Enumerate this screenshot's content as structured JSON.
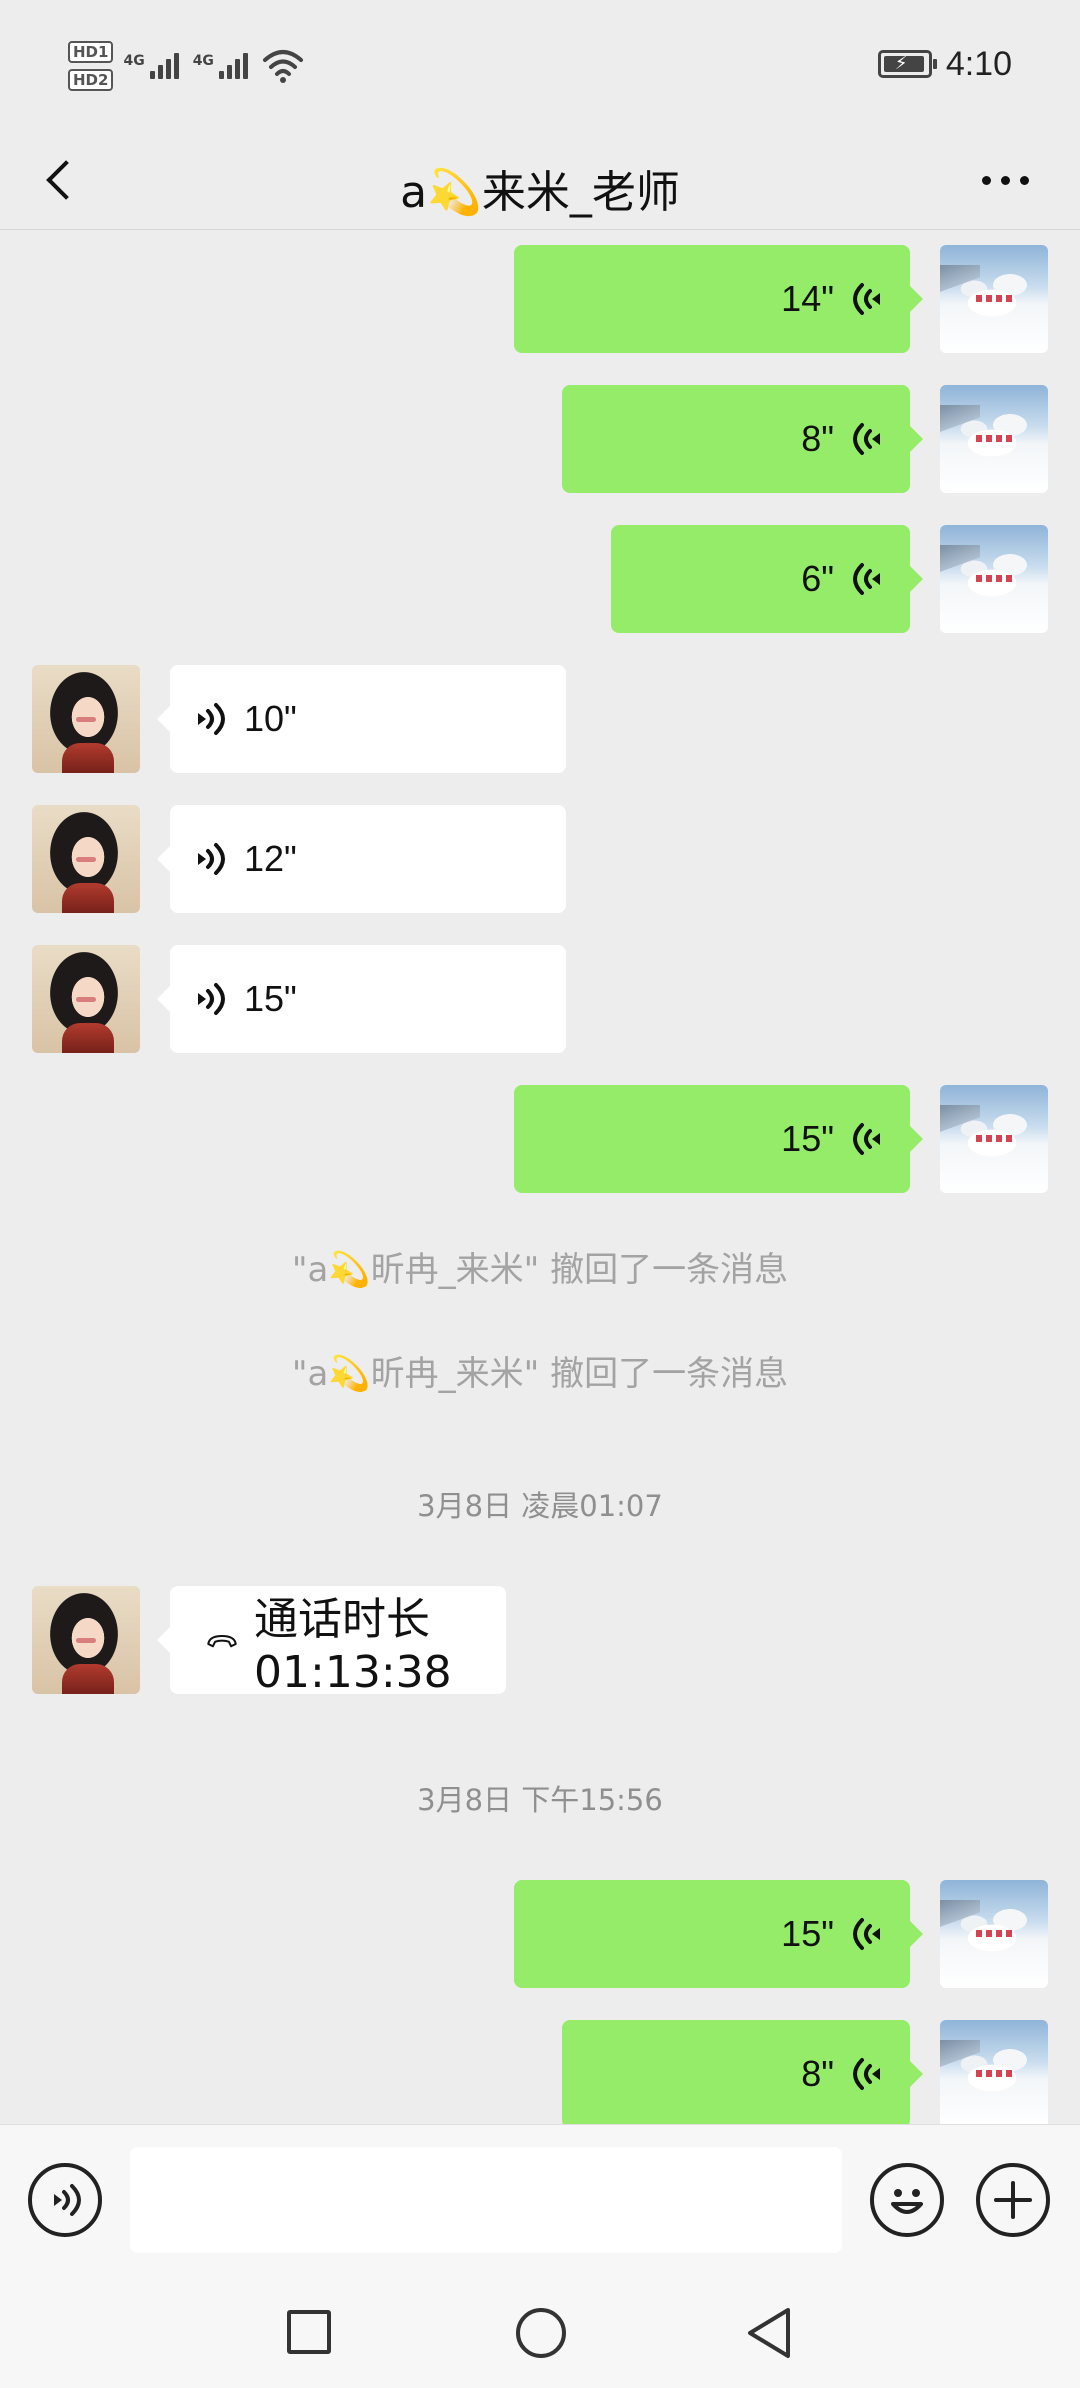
{
  "status_bar": {
    "hd1": "HD1",
    "hd2": "HD2",
    "net1": "4G",
    "net2": "4G",
    "time": "4:10"
  },
  "header": {
    "title": "a💫来米_老师"
  },
  "messages": [
    {
      "type": "voice",
      "dir": "out",
      "duration": "14\""
    },
    {
      "type": "voice",
      "dir": "out",
      "duration": "8\""
    },
    {
      "type": "voice",
      "dir": "out",
      "duration": "6\""
    },
    {
      "type": "voice",
      "dir": "in",
      "duration": "10\""
    },
    {
      "type": "voice",
      "dir": "in",
      "duration": "12\""
    },
    {
      "type": "voice",
      "dir": "in",
      "duration": "15\""
    },
    {
      "type": "voice",
      "dir": "out",
      "duration": "15\""
    },
    {
      "type": "system",
      "text": "\"a💫昕冉_来米\" 撤回了一条消息"
    },
    {
      "type": "system",
      "text": "\"a💫昕冉_来米\" 撤回了一条消息"
    },
    {
      "type": "timestamp",
      "text": "3月8日 凌晨01:07"
    },
    {
      "type": "call",
      "dir": "in",
      "text": "通话时长 01:13:38"
    },
    {
      "type": "timestamp",
      "text": "3月8日 下午15:56"
    },
    {
      "type": "voice",
      "dir": "out",
      "duration": "15\""
    },
    {
      "type": "voice",
      "dir": "out",
      "duration": "8\""
    }
  ],
  "input": {
    "value": "",
    "placeholder": ""
  },
  "icons": {
    "back": "chevron-left-icon",
    "more": "more-dots-icon",
    "voice_toggle": "voice-input-icon",
    "emoji": "emoji-icon",
    "plus": "plus-icon",
    "call": "phone-hangup-icon"
  },
  "colors": {
    "outgoing_bubble": "#95ec69",
    "incoming_bubble": "#ffffff",
    "background": "#ededed"
  }
}
